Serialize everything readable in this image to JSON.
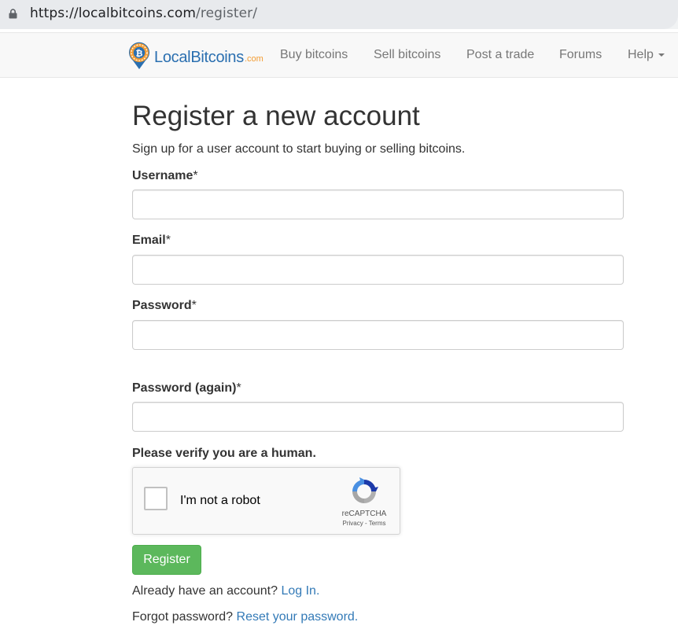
{
  "browser": {
    "url_host": "https://localbitcoins.com",
    "url_path": "/register/"
  },
  "navbar": {
    "brand_name": "LocalBitcoins",
    "brand_suffix": ".com",
    "items": [
      {
        "label": "Buy bitcoins"
      },
      {
        "label": "Sell bitcoins"
      },
      {
        "label": "Post a trade"
      },
      {
        "label": "Forums"
      },
      {
        "label": "Help"
      }
    ]
  },
  "main": {
    "title": "Register a new account",
    "lead": "Sign up for a user account to start buying or selling bitcoins.",
    "fields": {
      "username": {
        "label": "Username",
        "required_mark": "*",
        "value": ""
      },
      "email": {
        "label": "Email",
        "required_mark": "*",
        "value": ""
      },
      "password": {
        "label": "Password",
        "required_mark": "*",
        "value": ""
      },
      "password_again": {
        "label": "Password (again)",
        "required_mark": "*",
        "value": ""
      }
    },
    "verify_label": "Please verify you are a human.",
    "recaptcha": {
      "label": "I'm not a robot",
      "brand": "reCAPTCHA",
      "privacy": "Privacy",
      "separator": " - ",
      "terms": "Terms"
    },
    "register_button": "Register",
    "login_prompt": "Already have an account?",
    "login_link": "Log In.",
    "forgot_prompt": "Forgot password?",
    "reset_link": "Reset your password."
  },
  "colors": {
    "brand_blue": "#2a6fb0",
    "brand_orange": "#f39c32",
    "link": "#337ab7",
    "success": "#5cb85c"
  }
}
